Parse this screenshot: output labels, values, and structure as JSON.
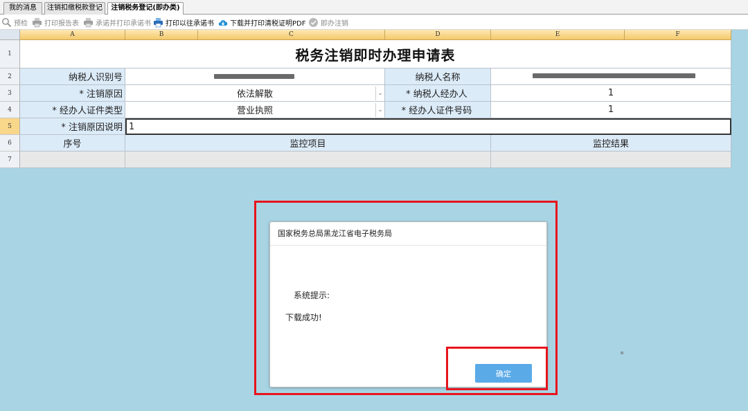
{
  "tabs": [
    {
      "label": "我的消息"
    },
    {
      "label": "注销扣缴税款登记"
    },
    {
      "label": "注销税务登记(即办类)"
    }
  ],
  "toolbar": {
    "preview": "预检",
    "print_report": "打印报告表",
    "print_commit": "承诺并打印承诺书",
    "print_old_commit": "打印以往承诺书",
    "download_pdf": "下载并打印清税证明PDF",
    "instant_cancel": "即办注销"
  },
  "columns": [
    "A",
    "B",
    "C",
    "D",
    "E",
    "F"
  ],
  "rows": [
    "1",
    "2",
    "3",
    "4",
    "5",
    "6",
    "7"
  ],
  "form": {
    "title": "税务注销即时办理申请表",
    "taxpayer_id_label": "纳税人识别号",
    "taxpayer_name_label": "纳税人名称",
    "cancel_reason_label": "* 注销原因",
    "cancel_reason_value": "依法解散",
    "handler_label": "* 纳税人经办人",
    "handler_value": "1",
    "id_type_label": "* 经办人证件类型",
    "id_type_value": "营业执照",
    "id_number_label": "* 经办人证件号码",
    "id_number_value": "1",
    "reason_desc_label": "* 注销原因说明",
    "reason_desc_value": "1",
    "seq_header": "序号",
    "item_header": "监控项目",
    "result_header": "监控结果"
  },
  "dialog": {
    "title": "国家税务总局黑龙江省电子税务局",
    "prompt": "系统提示:",
    "message": "下载成功!",
    "ok": "确定"
  },
  "colors": {
    "highlight": "#e8141b",
    "ok_button": "#5aaae8",
    "label_bg": "#dcebf8",
    "background": "#a8d4e4"
  }
}
